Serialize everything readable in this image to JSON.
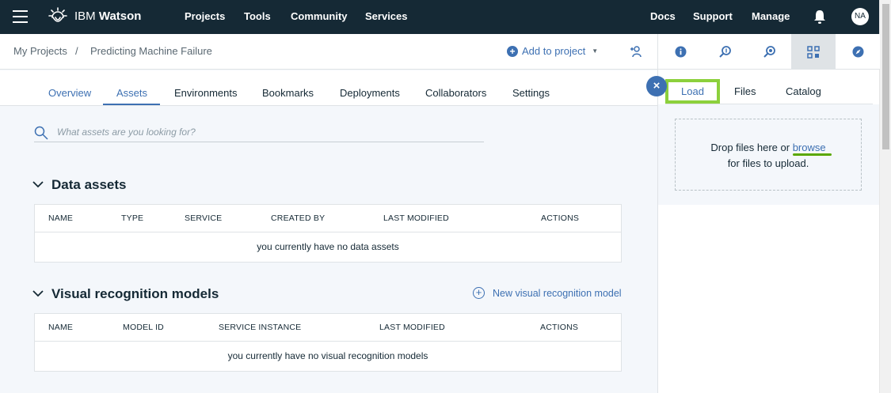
{
  "topnav": {
    "brand_prefix": "IBM ",
    "brand_name": "Watson",
    "items": [
      "Projects",
      "Tools",
      "Community",
      "Services",
      "Docs",
      "Support",
      "Manage"
    ],
    "avatar_initials": "NA"
  },
  "breadcrumb": {
    "parent": "My Projects",
    "separator": "/",
    "current": "Predicting Machine Failure"
  },
  "add_to_project": {
    "label": "Add to project"
  },
  "tabs": [
    {
      "label": "Overview",
      "active": false
    },
    {
      "label": "Assets",
      "active": true
    },
    {
      "label": "Environments",
      "active": false
    },
    {
      "label": "Bookmarks",
      "active": false
    },
    {
      "label": "Deployments",
      "active": false
    },
    {
      "label": "Collaborators",
      "active": false
    },
    {
      "label": "Settings",
      "active": false
    }
  ],
  "search": {
    "placeholder": "What assets are you looking for?"
  },
  "data_assets": {
    "title": "Data assets",
    "columns": [
      "NAME",
      "TYPE",
      "SERVICE",
      "CREATED BY",
      "LAST MODIFIED",
      "ACTIONS"
    ],
    "empty_message": "you currently have no data assets"
  },
  "visual_recognition": {
    "title": "Visual recognition models",
    "new_label": "New visual recognition model",
    "columns": [
      "NAME",
      "MODEL ID",
      "SERVICE INSTANCE",
      "LAST MODIFIED",
      "ACTIONS"
    ],
    "empty_message": "you currently have no visual recognition models"
  },
  "right_panel": {
    "icons": [
      "info-icon",
      "find-and-add-icon",
      "explore-icon",
      "data-icon",
      "compass-icon"
    ],
    "active_icon": "data-icon",
    "close_label": "×",
    "tabs": [
      "Load",
      "Files",
      "Catalog"
    ],
    "active_tab": "Load",
    "drop_text_1": "Drop files here or ",
    "browse_label": "browse",
    "drop_text_2": "for files to upload."
  },
  "colors": {
    "nav_bg": "#152935",
    "accent": "#3d70b2",
    "highlight": "#8cd03c",
    "page_bg": "#f4f7fb"
  }
}
